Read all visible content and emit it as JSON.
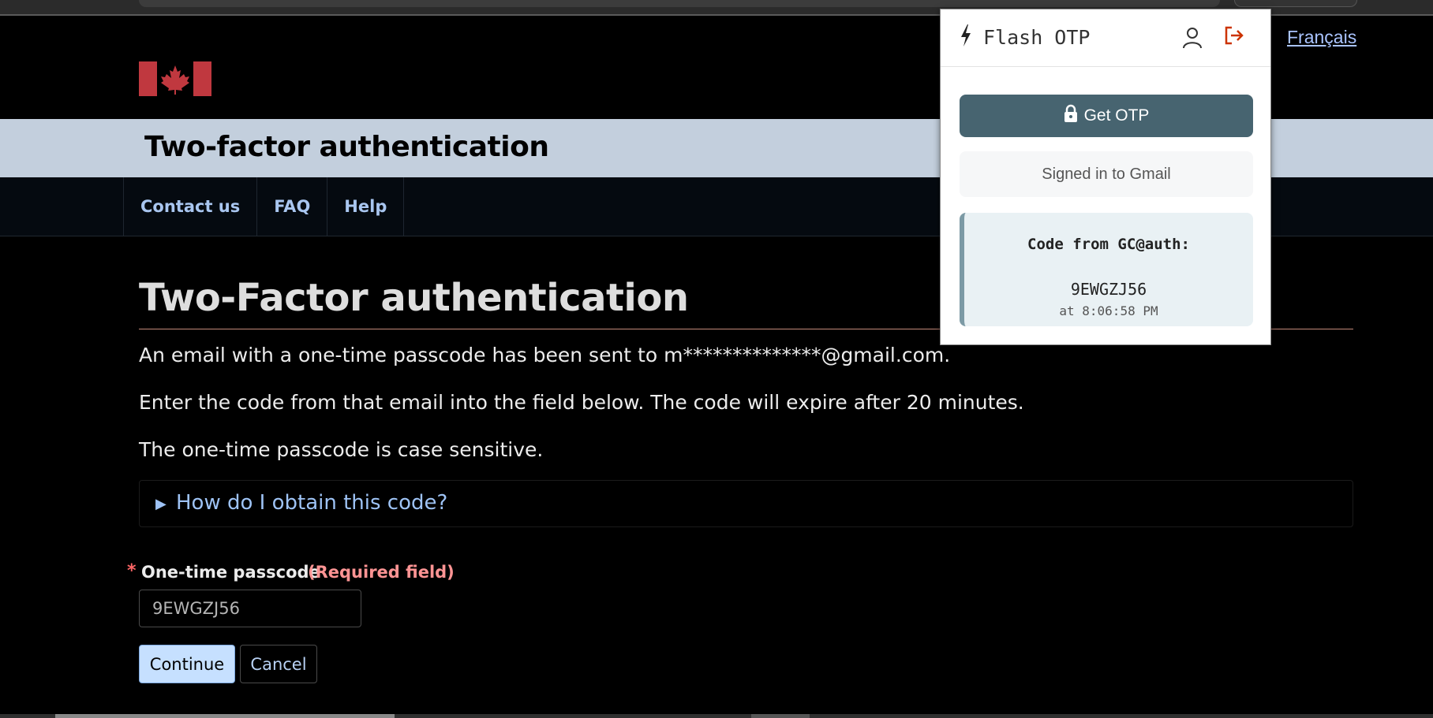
{
  "header": {
    "language_link": "Français"
  },
  "site": {
    "title": "Two-factor authentication"
  },
  "nav": {
    "items": [
      {
        "label": "Contact us"
      },
      {
        "label": "FAQ"
      },
      {
        "label": "Help"
      }
    ]
  },
  "main": {
    "heading": "Two-Factor authentication",
    "paragraphs": [
      "An email with a one-time passcode has been sent to m**************@gmail.com.",
      "Enter the code from that email into the field below. The code will expire after 20 minutes.",
      "The one-time passcode is case sensitive."
    ],
    "details_summary": "How do I obtain this code?",
    "field": {
      "required_marker": "*",
      "label": "One-time passcode",
      "required_text": "(Required field)",
      "value": "9EWGZJ56"
    },
    "buttons": {
      "continue": "Continue",
      "cancel": "Cancel"
    }
  },
  "extension": {
    "title": "Flash OTP",
    "get_otp_label": "Get OTP",
    "signed_in_text": "Signed in to Gmail",
    "code_from": "Code from GC@auth:",
    "code": "9EWGZJ56",
    "code_time": "at 8:06:58 PM"
  },
  "colors": {
    "title_band": "#c3cfdd",
    "link": "#9ec3f5",
    "required": "#ff9494",
    "otp_button": "#476470",
    "logout_icon": "#cc3300"
  },
  "icons": [
    "canada-flag-icon",
    "bolt-icon",
    "user-icon",
    "logout-icon",
    "lock-icon",
    "triangle-right-icon"
  ]
}
